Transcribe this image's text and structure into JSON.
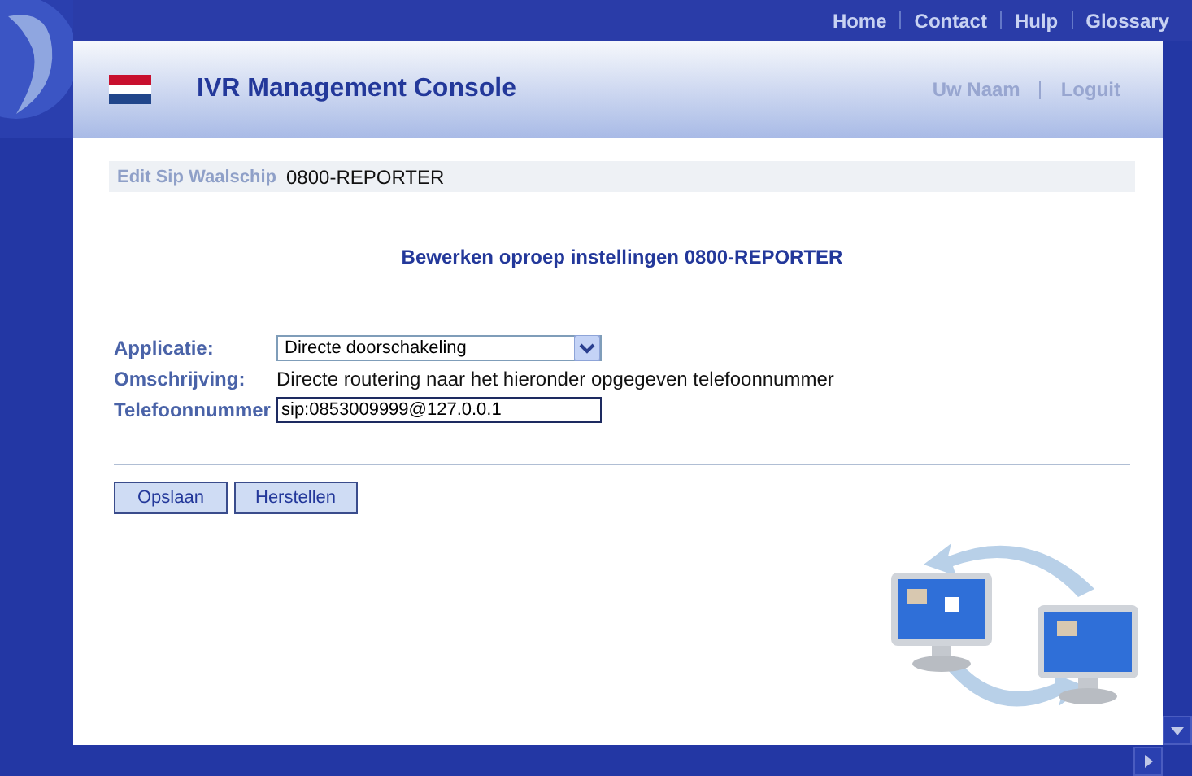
{
  "top_nav": [
    {
      "label": "Home"
    },
    {
      "label": "Contact"
    },
    {
      "label": "Hulp"
    },
    {
      "label": "Glossary"
    }
  ],
  "header": {
    "title": "IVR Management Console",
    "user_links": [
      {
        "label": "Uw Naam"
      },
      {
        "label": "Loguit"
      }
    ]
  },
  "breadcrumb": {
    "label": "Edit Sip Waalschip",
    "value": "0800-REPORTER"
  },
  "heading": "Bewerken oproep instellingen 0800-REPORTER",
  "form": [
    {
      "kind": "select",
      "label": "Applicatie:",
      "value": "Directe doorschakeling"
    },
    {
      "kind": "text",
      "label": "Omschrijving:",
      "value": "Directe routering naar het hieronder opgegeven telefoonnummer"
    },
    {
      "kind": "input",
      "label": "Telefoonnummer",
      "value": "sip:0853009999@127.0.0.1"
    }
  ],
  "buttons": [
    "Opslaan",
    "Herstellen"
  ]
}
